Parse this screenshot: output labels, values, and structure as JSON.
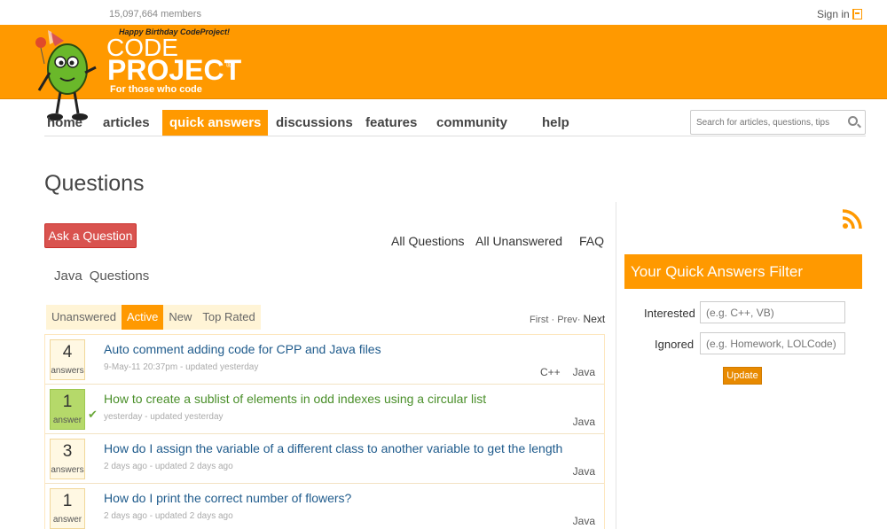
{
  "header": {
    "members": "15,097,664 members",
    "signin": "Sign in",
    "birthday": "Happy Birthday CodeProject!",
    "logo_code": "CODE",
    "logo_project": "PROJECT",
    "logo_reg": "®",
    "tagline": "For those who code"
  },
  "nav": {
    "items": [
      "home",
      "articles",
      "quick answers",
      "discussions",
      "features",
      "community",
      "help"
    ],
    "search_placeholder": "Search for articles, questions, tips"
  },
  "page": {
    "title": "Questions",
    "ask_button": "Ask a Question",
    "links": [
      "All Questions",
      "All Unanswered",
      "FAQ"
    ],
    "filter_label_tag": "Java",
    "filter_label_word": "Questions",
    "tabs": [
      "Unanswered",
      "Active",
      "New",
      "Top Rated"
    ],
    "active_tab": "Active",
    "pager": {
      "first": "First",
      "sep1": "·",
      "prev": "Prev",
      "sep2": "·",
      "next": "Next"
    }
  },
  "questions": [
    {
      "count": "4",
      "label": "answers",
      "title": "Auto comment adding code for CPP and Java files",
      "meta": "9-May-11 20:37pm - updated yesterday",
      "tags": [
        "C++",
        "Java"
      ],
      "accepted": false
    },
    {
      "count": "1",
      "label": "answer",
      "title": "How to create a sublist of elements in odd indexes using a circular list",
      "meta": "yesterday - updated yesterday",
      "tags": [
        "Java"
      ],
      "accepted": true
    },
    {
      "count": "3",
      "label": "answers",
      "title": "How do I assign the variable of a different class to another variable to get the length",
      "meta": "2 days ago - updated 2 days ago",
      "tags": [
        "Java"
      ],
      "accepted": false
    },
    {
      "count": "1",
      "label": "answer",
      "title": "How do I print the correct number of flowers?",
      "meta": "2 days ago - updated 2 days ago",
      "tags": [
        "Java"
      ],
      "accepted": false
    }
  ],
  "sidebar": {
    "filter_title": "Your Quick Answers Filter",
    "interested_label": "Interested",
    "interested_placeholder": "(e.g. C++, VB)",
    "ignored_label": "Ignored",
    "ignored_placeholder": "(e.g. Homework, LOLCode)",
    "update_button": "Update"
  },
  "colors": {
    "accent": "#ff9900",
    "ask": "#d9534f",
    "link": "#1f5b8c",
    "accepted": "#b5d96a"
  },
  "icons": [
    "mascot-logo",
    "signin-icon",
    "search-icon",
    "rss-icon",
    "check-icon"
  ]
}
